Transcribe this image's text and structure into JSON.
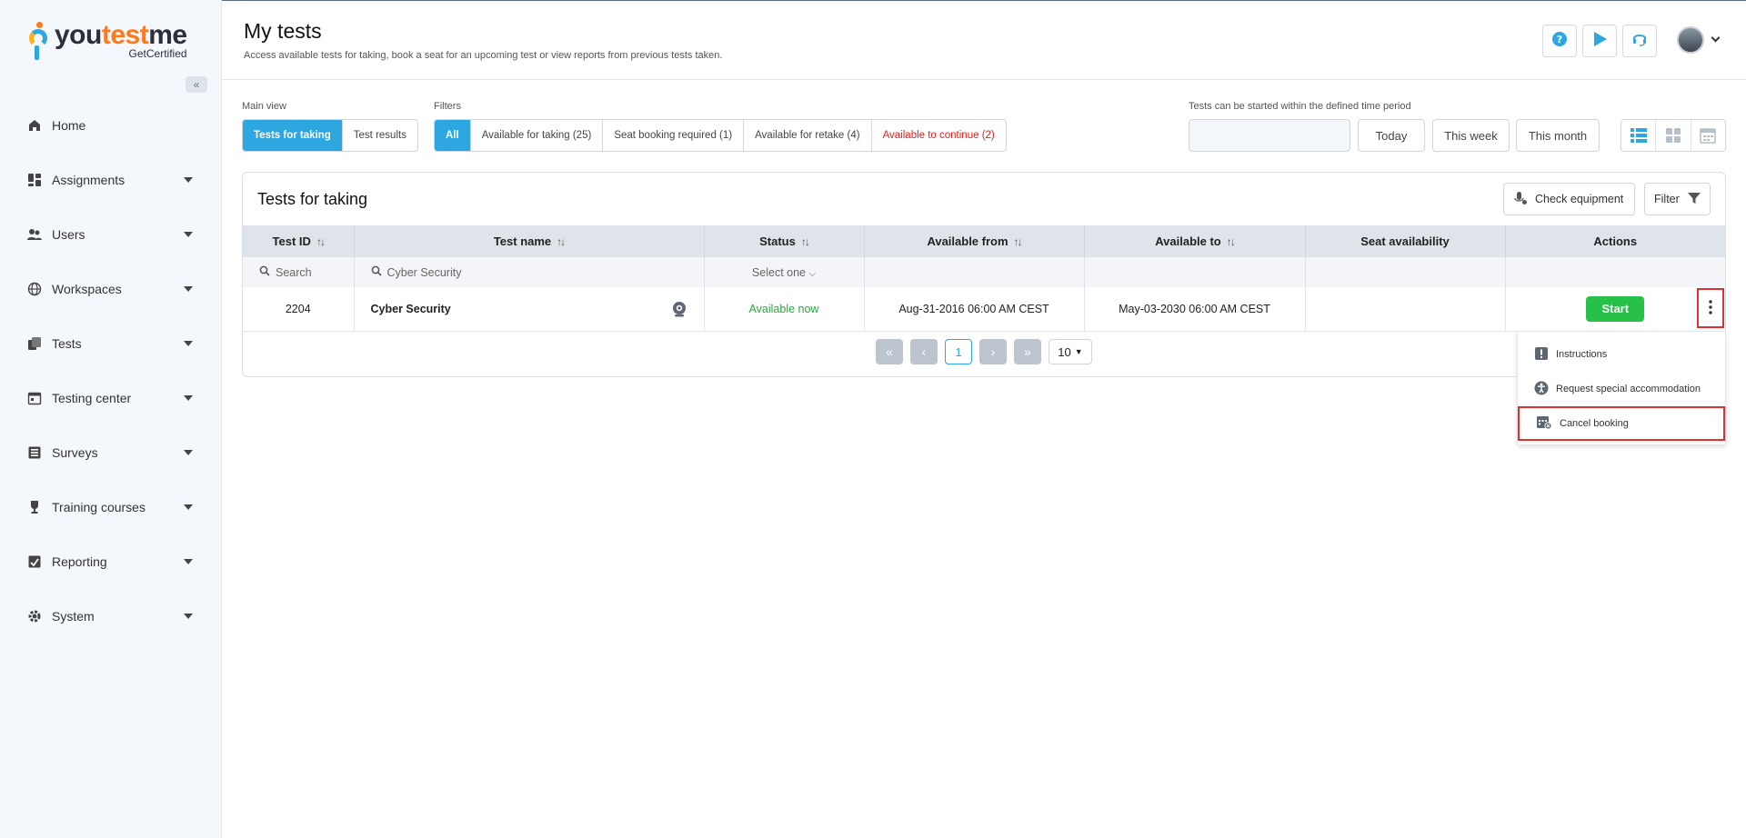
{
  "brand": {
    "word_a": "you",
    "word_b": "test",
    "word_c": "me",
    "sub": "GetCertified"
  },
  "sidebar": {
    "items": [
      {
        "label": "Home",
        "icon": "home-icon",
        "has_caret": false
      },
      {
        "label": "Assignments",
        "icon": "assignments-icon",
        "has_caret": true
      },
      {
        "label": "Users",
        "icon": "users-icon",
        "has_caret": true
      },
      {
        "label": "Workspaces",
        "icon": "globe-icon",
        "has_caret": true
      },
      {
        "label": "Tests",
        "icon": "tests-icon",
        "has_caret": true
      },
      {
        "label": "Testing center",
        "icon": "calendar-icon",
        "has_caret": true
      },
      {
        "label": "Surveys",
        "icon": "survey-icon",
        "has_caret": true
      },
      {
        "label": "Training courses",
        "icon": "trophy-icon",
        "has_caret": true
      },
      {
        "label": "Reporting",
        "icon": "reporting-icon",
        "has_caret": true
      },
      {
        "label": "System",
        "icon": "gear-icon",
        "has_caret": true
      }
    ]
  },
  "header": {
    "title": "My tests",
    "subtitle": "Access available tests for taking, book a seat for an upcoming test or view reports from previous tests taken."
  },
  "main_view": {
    "label": "Main view",
    "options": [
      "Tests for taking",
      "Test results"
    ],
    "active": "Tests for taking"
  },
  "filters": {
    "label": "Filters",
    "options": [
      "All",
      "Available for taking (25)",
      "Seat booking required (1)",
      "Available for retake (4)",
      "Available to continue (2)"
    ],
    "active": "All"
  },
  "time_period": {
    "label": "Tests can be started within the defined time period",
    "today": "Today",
    "this_week": "This week",
    "this_month": "This month"
  },
  "card": {
    "title": "Tests for taking",
    "check_equipment": "Check equipment",
    "filter": "Filter"
  },
  "table": {
    "columns": [
      "Test ID",
      "Test name",
      "Status",
      "Available from",
      "Available to",
      "Seat availability",
      "Actions"
    ],
    "filters": {
      "test_id_placeholder": "Search",
      "test_name_value": "Cyber Security",
      "status_placeholder": "Select one"
    },
    "rows": [
      {
        "id": "2204",
        "name": "Cyber Security",
        "status": "Available now",
        "available_from": "Aug-31-2016 06:00 AM CEST",
        "available_to": "May-03-2030 06:00 AM CEST",
        "seat": "",
        "action": "Start"
      }
    ]
  },
  "pager": {
    "current": "1",
    "page_size": "10"
  },
  "menu": {
    "items": [
      "Instructions",
      "Request special accommodation",
      "Cancel booking"
    ]
  },
  "colors": {
    "accent": "#2ea7e0",
    "success": "#27c049",
    "danger": "#e02020"
  }
}
